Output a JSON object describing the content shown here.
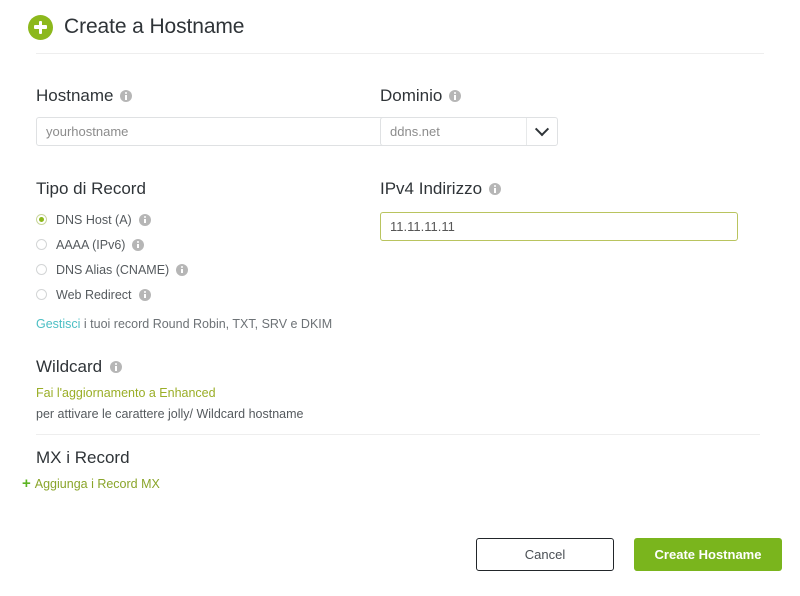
{
  "header": {
    "title": "Create a Hostname",
    "add_icon": "plus-circle-icon"
  },
  "form": {
    "hostname": {
      "label": "Hostname",
      "info_icon": "info-icon",
      "placeholder": "yourhostname",
      "value": ""
    },
    "domain": {
      "label": "Dominio",
      "info_icon": "info-icon",
      "selected": "ddns.net",
      "chevron_icon": "chevron-down-icon"
    },
    "record_type": {
      "label": "Tipo di Record",
      "options": [
        {
          "label": "DNS Host (A)",
          "selected": true
        },
        {
          "label": "AAAA (IPv6)",
          "selected": false
        },
        {
          "label": "DNS Alias (CNAME)",
          "selected": false
        },
        {
          "label": "Web Redirect",
          "selected": false
        }
      ],
      "manage_link": "Gestisci",
      "manage_text": " i tuoi record Round Robin, TXT, SRV e DKIM"
    },
    "ipv4": {
      "label": "IPv4 Indirizzo",
      "info_icon": "info-icon",
      "value": "11.11.11.11",
      "focused": true
    },
    "wildcard": {
      "label": "Wildcard",
      "info_icon": "info-icon",
      "upgrade_link": "Fai l'aggiornamento a Enhanced",
      "description": "per attivare le carattere jolly/ Wildcard hostname"
    },
    "mx": {
      "title": "MX i Record",
      "add_label": "Aggiunga i Record MX",
      "add_icon": "plus-icon",
      "plus_glyph": "+"
    }
  },
  "footer": {
    "cancel_label": "Cancel",
    "submit_label": "Create Hostname"
  },
  "colors": {
    "brand_green": "#7ab51d",
    "icon_green": "#8cb81c",
    "olive_link": "#9aae27",
    "teal_link": "#4dbfc4",
    "focus_border": "#b9c45f"
  }
}
